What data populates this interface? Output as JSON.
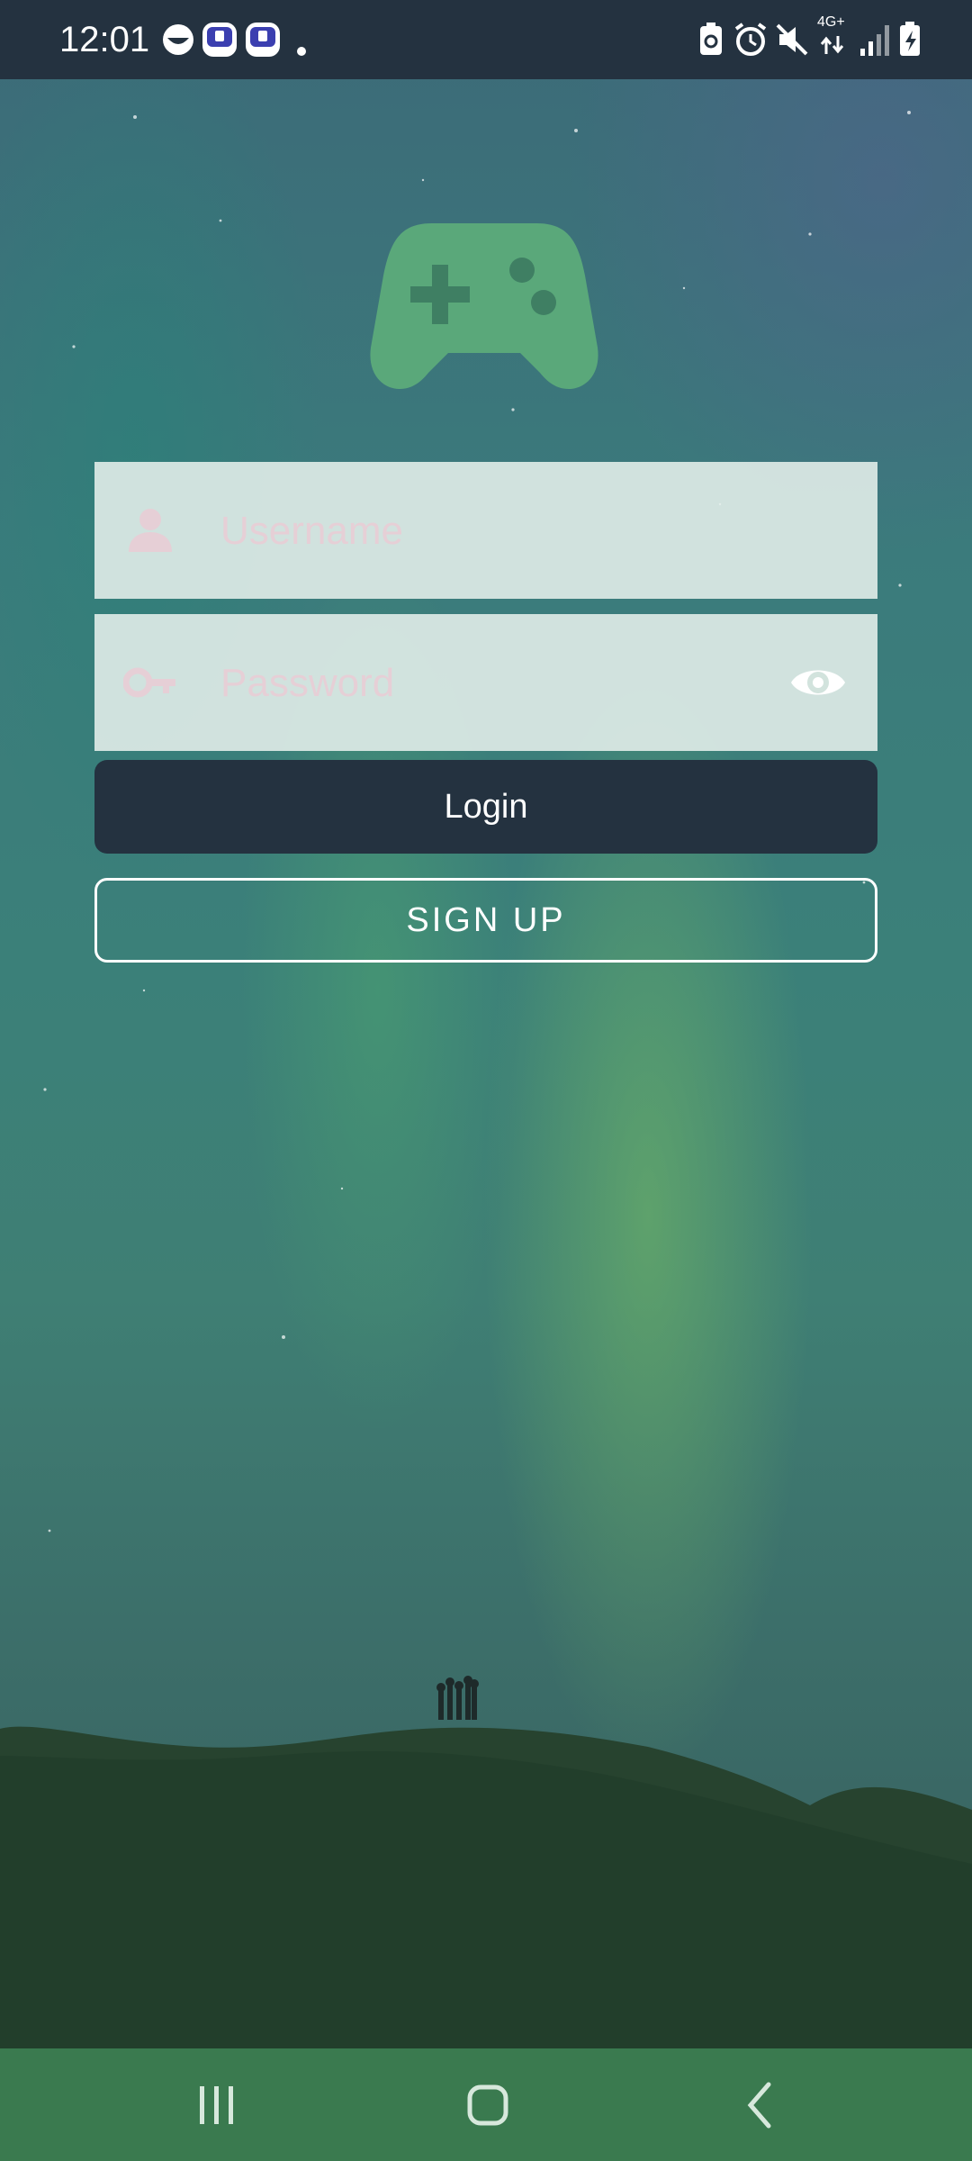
{
  "status_bar": {
    "time": "12:01",
    "network": "4G+",
    "left_icons": [
      "notification-app-icon",
      "app-badge-icon",
      "app-badge-icon"
    ],
    "right_icons": [
      "battery-saver-icon",
      "alarm-icon",
      "mute-icon",
      "signal-icon",
      "battery-charging-icon"
    ]
  },
  "login": {
    "username_placeholder": "Username",
    "password_placeholder": "Password",
    "login_label": "Login",
    "signup_label": "SIGN UP"
  },
  "colors": {
    "primary": "#243240",
    "logo": "#5aa87a",
    "nav_bar": "#3a7a4f"
  },
  "nav_bar": {
    "buttons": [
      "recent-apps-icon",
      "home-icon",
      "back-icon"
    ]
  }
}
